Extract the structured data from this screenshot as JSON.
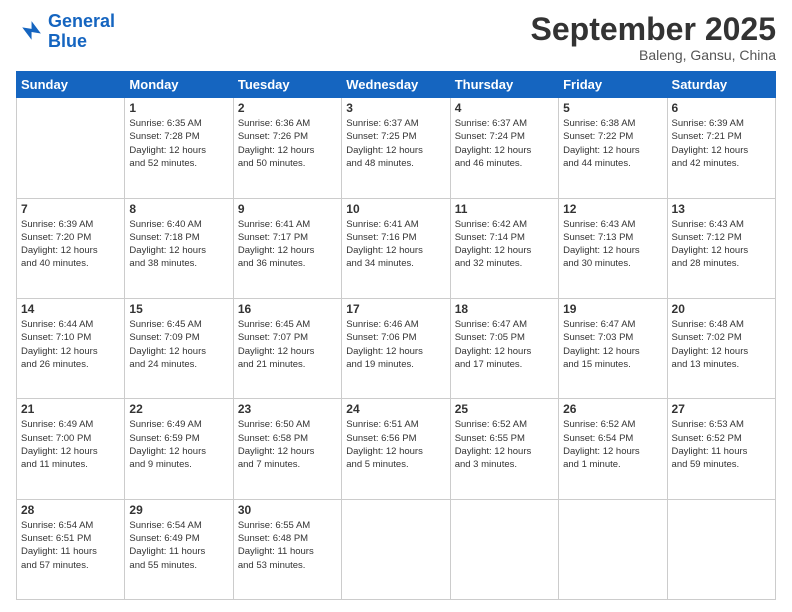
{
  "header": {
    "logo_line1": "General",
    "logo_line2": "Blue",
    "title": "September 2025",
    "subtitle": "Baleng, Gansu, China"
  },
  "calendar": {
    "days_of_week": [
      "Sunday",
      "Monday",
      "Tuesday",
      "Wednesday",
      "Thursday",
      "Friday",
      "Saturday"
    ],
    "weeks": [
      [
        {
          "day": "",
          "info": ""
        },
        {
          "day": "1",
          "info": "Sunrise: 6:35 AM\nSunset: 7:28 PM\nDaylight: 12 hours\nand 52 minutes."
        },
        {
          "day": "2",
          "info": "Sunrise: 6:36 AM\nSunset: 7:26 PM\nDaylight: 12 hours\nand 50 minutes."
        },
        {
          "day": "3",
          "info": "Sunrise: 6:37 AM\nSunset: 7:25 PM\nDaylight: 12 hours\nand 48 minutes."
        },
        {
          "day": "4",
          "info": "Sunrise: 6:37 AM\nSunset: 7:24 PM\nDaylight: 12 hours\nand 46 minutes."
        },
        {
          "day": "5",
          "info": "Sunrise: 6:38 AM\nSunset: 7:22 PM\nDaylight: 12 hours\nand 44 minutes."
        },
        {
          "day": "6",
          "info": "Sunrise: 6:39 AM\nSunset: 7:21 PM\nDaylight: 12 hours\nand 42 minutes."
        }
      ],
      [
        {
          "day": "7",
          "info": "Sunrise: 6:39 AM\nSunset: 7:20 PM\nDaylight: 12 hours\nand 40 minutes."
        },
        {
          "day": "8",
          "info": "Sunrise: 6:40 AM\nSunset: 7:18 PM\nDaylight: 12 hours\nand 38 minutes."
        },
        {
          "day": "9",
          "info": "Sunrise: 6:41 AM\nSunset: 7:17 PM\nDaylight: 12 hours\nand 36 minutes."
        },
        {
          "day": "10",
          "info": "Sunrise: 6:41 AM\nSunset: 7:16 PM\nDaylight: 12 hours\nand 34 minutes."
        },
        {
          "day": "11",
          "info": "Sunrise: 6:42 AM\nSunset: 7:14 PM\nDaylight: 12 hours\nand 32 minutes."
        },
        {
          "day": "12",
          "info": "Sunrise: 6:43 AM\nSunset: 7:13 PM\nDaylight: 12 hours\nand 30 minutes."
        },
        {
          "day": "13",
          "info": "Sunrise: 6:43 AM\nSunset: 7:12 PM\nDaylight: 12 hours\nand 28 minutes."
        }
      ],
      [
        {
          "day": "14",
          "info": "Sunrise: 6:44 AM\nSunset: 7:10 PM\nDaylight: 12 hours\nand 26 minutes."
        },
        {
          "day": "15",
          "info": "Sunrise: 6:45 AM\nSunset: 7:09 PM\nDaylight: 12 hours\nand 24 minutes."
        },
        {
          "day": "16",
          "info": "Sunrise: 6:45 AM\nSunset: 7:07 PM\nDaylight: 12 hours\nand 21 minutes."
        },
        {
          "day": "17",
          "info": "Sunrise: 6:46 AM\nSunset: 7:06 PM\nDaylight: 12 hours\nand 19 minutes."
        },
        {
          "day": "18",
          "info": "Sunrise: 6:47 AM\nSunset: 7:05 PM\nDaylight: 12 hours\nand 17 minutes."
        },
        {
          "day": "19",
          "info": "Sunrise: 6:47 AM\nSunset: 7:03 PM\nDaylight: 12 hours\nand 15 minutes."
        },
        {
          "day": "20",
          "info": "Sunrise: 6:48 AM\nSunset: 7:02 PM\nDaylight: 12 hours\nand 13 minutes."
        }
      ],
      [
        {
          "day": "21",
          "info": "Sunrise: 6:49 AM\nSunset: 7:00 PM\nDaylight: 12 hours\nand 11 minutes."
        },
        {
          "day": "22",
          "info": "Sunrise: 6:49 AM\nSunset: 6:59 PM\nDaylight: 12 hours\nand 9 minutes."
        },
        {
          "day": "23",
          "info": "Sunrise: 6:50 AM\nSunset: 6:58 PM\nDaylight: 12 hours\nand 7 minutes."
        },
        {
          "day": "24",
          "info": "Sunrise: 6:51 AM\nSunset: 6:56 PM\nDaylight: 12 hours\nand 5 minutes."
        },
        {
          "day": "25",
          "info": "Sunrise: 6:52 AM\nSunset: 6:55 PM\nDaylight: 12 hours\nand 3 minutes."
        },
        {
          "day": "26",
          "info": "Sunrise: 6:52 AM\nSunset: 6:54 PM\nDaylight: 12 hours\nand 1 minute."
        },
        {
          "day": "27",
          "info": "Sunrise: 6:53 AM\nSunset: 6:52 PM\nDaylight: 11 hours\nand 59 minutes."
        }
      ],
      [
        {
          "day": "28",
          "info": "Sunrise: 6:54 AM\nSunset: 6:51 PM\nDaylight: 11 hours\nand 57 minutes."
        },
        {
          "day": "29",
          "info": "Sunrise: 6:54 AM\nSunset: 6:49 PM\nDaylight: 11 hours\nand 55 minutes."
        },
        {
          "day": "30",
          "info": "Sunrise: 6:55 AM\nSunset: 6:48 PM\nDaylight: 11 hours\nand 53 minutes."
        },
        {
          "day": "",
          "info": ""
        },
        {
          "day": "",
          "info": ""
        },
        {
          "day": "",
          "info": ""
        },
        {
          "day": "",
          "info": ""
        }
      ]
    ]
  }
}
